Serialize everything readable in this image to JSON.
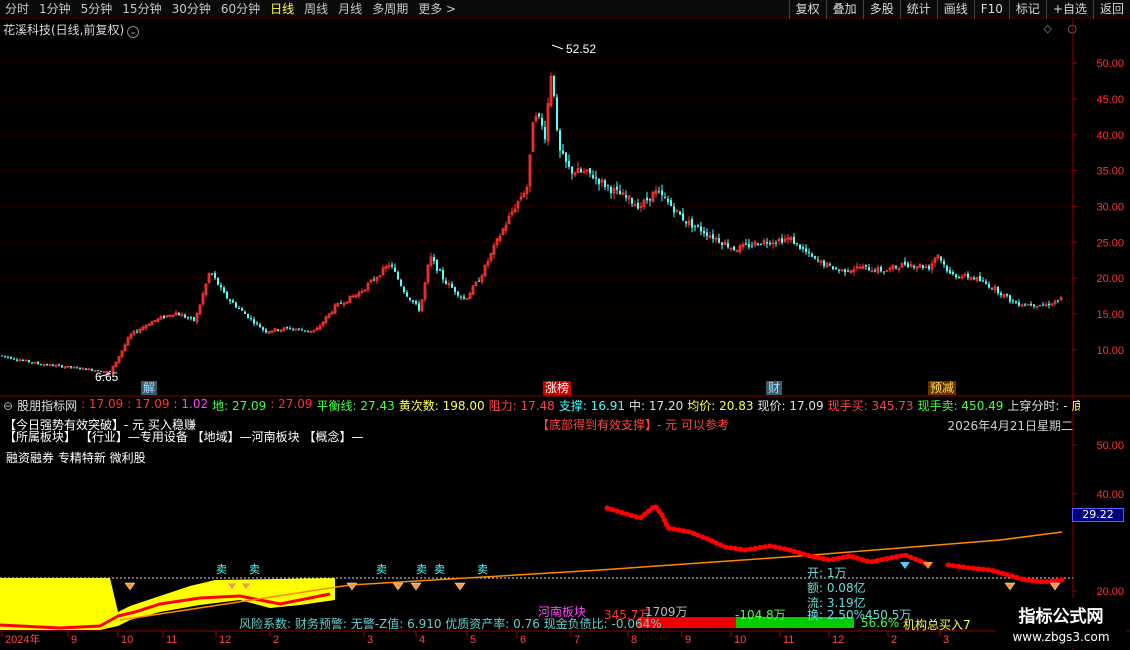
{
  "toolbar": {
    "periods": [
      "分时",
      "1分钟",
      "5分钟",
      "15分钟",
      "30分钟",
      "60分钟",
      "日线",
      "周线",
      "月线",
      "多周期",
      "更多 >"
    ],
    "active_period": "日线",
    "buttons": [
      "复权",
      "叠加",
      "多股",
      "统计",
      "画线",
      "F10",
      "标记",
      "+自选",
      "返回"
    ]
  },
  "stock_title": "花溪科技(日线,前复权)",
  "main_axis": {
    "ticks": [
      "50.00",
      "45.00",
      "40.00",
      "35.00",
      "30.00",
      "25.00",
      "20.00",
      "15.00",
      "10.00"
    ],
    "min": 5.5,
    "max": 53.5
  },
  "annotations": {
    "high": "52.52",
    "low": "6.65"
  },
  "event_tags": [
    {
      "label": "解",
      "color": "#9fe0ff",
      "bg": "#3a5a6a"
    },
    {
      "label": "涨榜",
      "color": "#ffffff",
      "bg": "#cc0000"
    },
    {
      "label": "财",
      "color": "#9fe0ff",
      "bg": "#3a5a6a"
    },
    {
      "label": "预减",
      "color": "#ffdd55",
      "bg": "#663300"
    }
  ],
  "indicator_bar": {
    "name": "股朋指标网",
    "items": [
      {
        "text": ": 17.09",
        "color": "#ff3333"
      },
      {
        "text": ": 17.09",
        "color": "#ff3333"
      },
      {
        "text": ": 1.02",
        "color": "#ff44ff"
      },
      {
        "text": "地: 27.09",
        "color": "#44ff44"
      },
      {
        "text": ": 27.09",
        "color": "#ff3333"
      },
      {
        "text": "平衡线: 27.43",
        "color": "#44ff44"
      },
      {
        "text": "黄次数: 198.00",
        "color": "#ffff44"
      },
      {
        "text": "阻力: 17.48",
        "color": "#ff4444"
      },
      {
        "text": "支撑: 16.91",
        "color": "#44ffff"
      },
      {
        "text": "中: 17.20",
        "color": "#e0e0e0"
      },
      {
        "text": "均价: 20.83",
        "color": "#ffff44"
      },
      {
        "text": "现价: 17.09",
        "color": "#e0e0e0"
      },
      {
        "text": "现手买: 345.73",
        "color": "#ff4444"
      },
      {
        "text": "现手卖: 450.49",
        "color": "#44ff44"
      },
      {
        "text": "上穿分时: -",
        "color": "#e0e0e0"
      },
      {
        "text": "底支: -",
        "color": "#ffff44"
      },
      {
        "text": "底价",
        "color": "#ff44ff"
      }
    ]
  },
  "info_lines": {
    "line1": "【今日强势有效突破】- 元 买入稳赚",
    "line2_center": "【底部得到有效支撑】- 元 可以参考",
    "industry": "【所属板块】 【行业】—专用设备 【地域】—河南板块 【概念】—",
    "concepts": "融资融券 专精特新 微利股",
    "date": "2026年4月21日星期二"
  },
  "lower_axis": {
    "ticks": [
      "50.00",
      "40.00",
      "20.00"
    ],
    "price_tag": "29.22"
  },
  "signals": [
    "卖",
    "卖",
    "卖",
    "卖",
    "卖",
    "卖"
  ],
  "right_stats": {
    "open": "开: 1万",
    "amount": "额: 0.08亿",
    "flow": "流: 3.19亿",
    "turnover": "换: 2.50%",
    "value": "450.5万"
  },
  "flow_labels": {
    "region": "河南板块",
    "buy_amount": "345.7万",
    "total": "1709万",
    "net": "-104.8万",
    "pct": "56.6%",
    "institution": "机构总买入7"
  },
  "bottom_info": {
    "risk": "风险系数: 财务预警: 无警-Z值: 6.910 优质资产率: 0.76 现金负债比: -0.064%"
  },
  "x_axis": [
    "2024年",
    "9",
    "10",
    "11",
    "12",
    "2",
    "3",
    "4",
    "5",
    "6",
    "7",
    "8",
    "9",
    "10",
    "11",
    "12",
    "2",
    "3"
  ],
  "watermark": {
    "title": "指标公式网",
    "url": "www.zbgs3.com"
  },
  "colors": {
    "up": "#ff3333",
    "down": "#55ffff",
    "yellow": "#ffff00",
    "red_line": "#ff0000",
    "orange_line": "#ff8800"
  }
}
